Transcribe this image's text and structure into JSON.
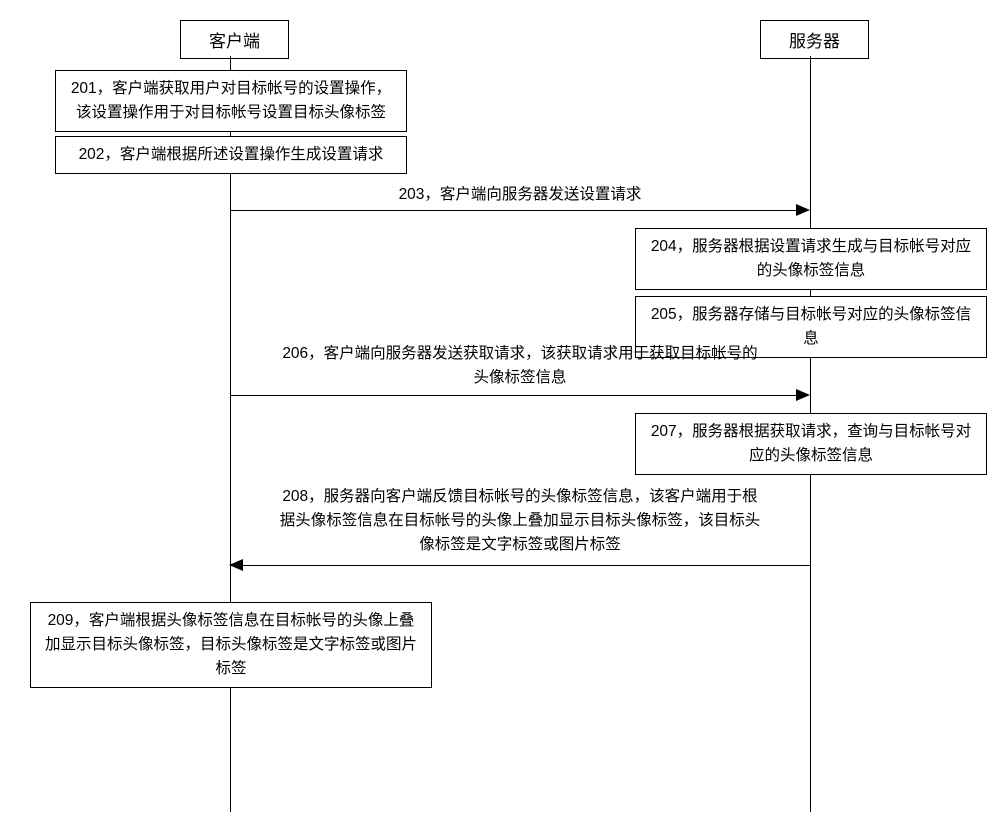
{
  "actors": {
    "client": "客户端",
    "server": "服务器"
  },
  "steps": {
    "s201": "201，客户端获取用户对目标帐号的设置操作，该设置操作用于对目标帐号设置目标头像标签",
    "s202": "202，客户端根据所述设置操作生成设置请求",
    "s204": "204，服务器根据设置请求生成与目标帐号对应的头像标签信息",
    "s205": "205，服务器存储与目标帐号对应的头像标签信息",
    "s207": "207，服务器根据获取请求，查询与目标帐号对应的头像标签信息",
    "s209": "209，客户端根据头像标签信息在目标帐号的头像上叠加显示目标头像标签，目标头像标签是文字标签或图片标签"
  },
  "messages": {
    "m203": "203，客户端向服务器发送设置请求",
    "m206": "206，客户端向服务器发送获取请求，该获取请求用于获取目标帐号的头像标签信息",
    "m208": "208，服务器向客户端反馈目标帐号的头像标签信息，该客户端用于根据头像标签信息在目标帐号的头像上叠加显示目标头像标签，该目标头像标签是文字标签或图片标签"
  }
}
